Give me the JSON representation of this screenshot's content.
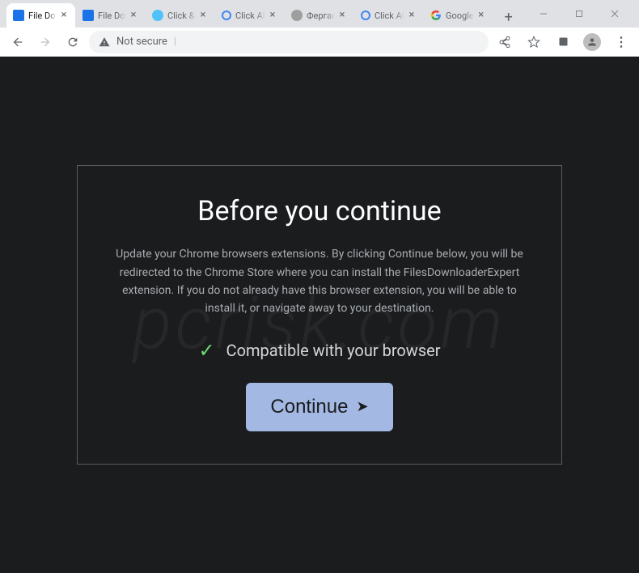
{
  "tabs": [
    {
      "title": "File Downl...",
      "favicon_type": "blue"
    },
    {
      "title": "File Downl...",
      "favicon_type": "blue"
    },
    {
      "title": "Click &quo...",
      "favicon_type": "cyan"
    },
    {
      "title": "Click Allow",
      "favicon_type": "ring"
    },
    {
      "title": "Фергана - ...",
      "favicon_type": "globe"
    },
    {
      "title": "Click Allow",
      "favicon_type": "ring"
    },
    {
      "title": "Google",
      "favicon_type": "google"
    }
  ],
  "omnibox": {
    "security_text": "Not secure",
    "separator": "|"
  },
  "modal": {
    "heading": "Before you continue",
    "body": "Update your Chrome browsers extensions. By clicking Continue below, you will be redirected to the Chrome Store where you can install the FilesDownloaderExpert extension. If you do not already have this browser extension, you will be able to install it, or navigate away to your destination.",
    "compatible_text": "Compatible with your browser",
    "button_label": "Continue"
  },
  "watermark": "pcrisk.com",
  "icons": {
    "close": "×",
    "plus": "+",
    "check": "✓",
    "arrow": "➤",
    "kebab": "⋮"
  }
}
